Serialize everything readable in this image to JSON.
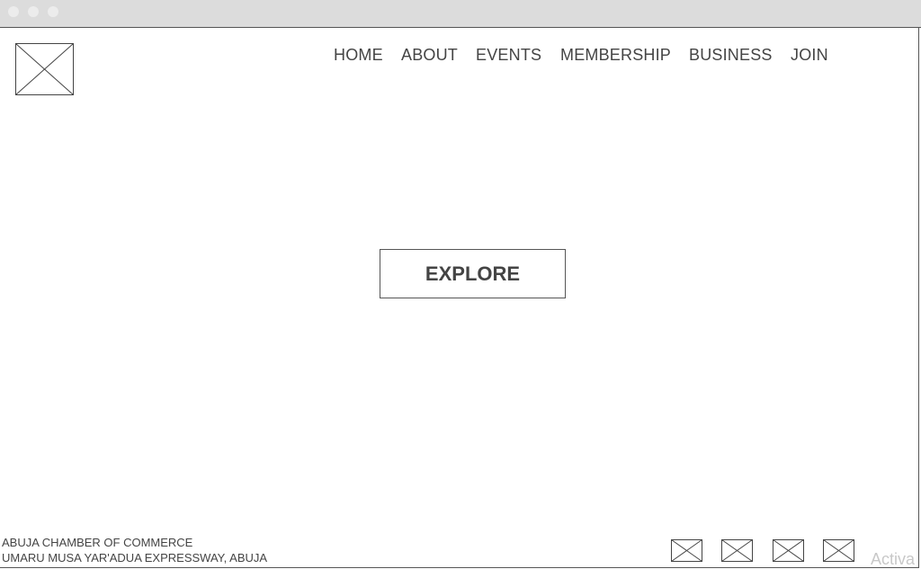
{
  "nav": {
    "items": [
      {
        "label": "HOME"
      },
      {
        "label": "ABOUT"
      },
      {
        "label": "EVENTS"
      },
      {
        "label": "MEMBERSHIP"
      },
      {
        "label": "BUSINESS"
      },
      {
        "label": "JOIN"
      }
    ]
  },
  "hero": {
    "explore_label": "EXPLORE"
  },
  "footer": {
    "org_name": "ABUJA CHAMBER OF COMMERCE",
    "address": "UMARU MUSA YAR'ADUA EXPRESSWAY, ABUJA"
  },
  "watermark": "Activa",
  "colors": {
    "titlebar": "#dcdcdc",
    "text": "#444444",
    "border": "#555555"
  }
}
